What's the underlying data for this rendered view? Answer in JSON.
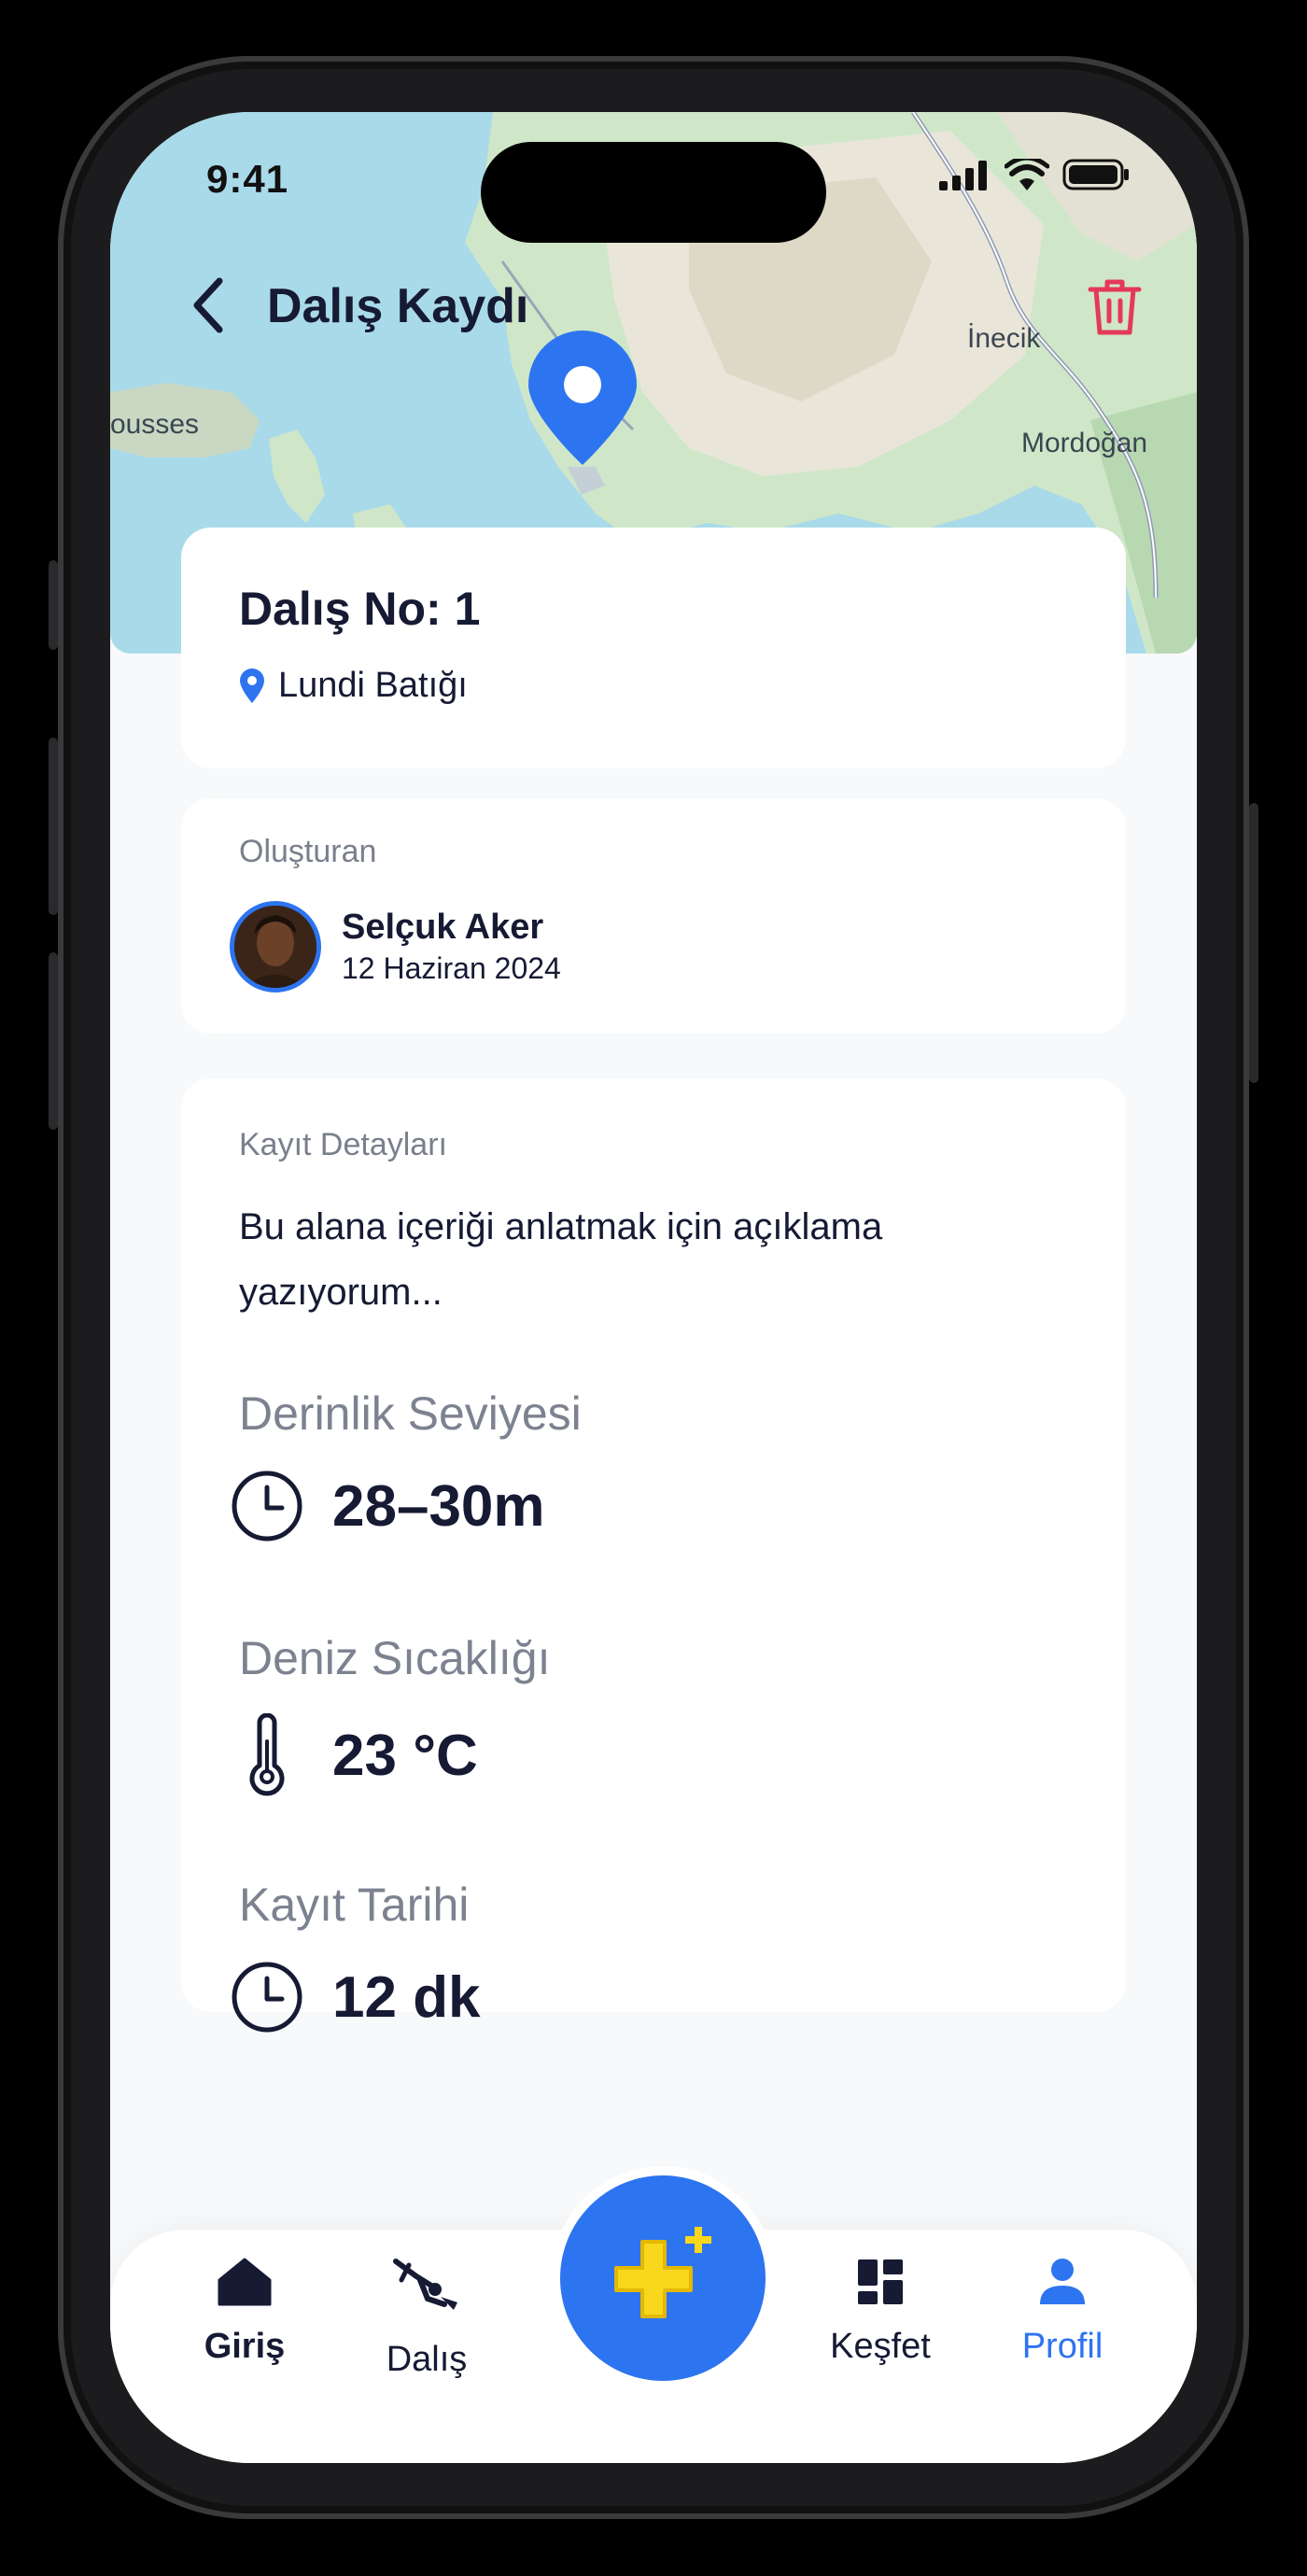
{
  "status_bar": {
    "time": "9:41"
  },
  "header": {
    "title": "Dalış Kaydı"
  },
  "map": {
    "labels": {
      "left_town": "ousses",
      "inecik": "İnecik",
      "mordogan": "Mordoğan"
    }
  },
  "dive": {
    "title": "Dalış No: 1",
    "location": "Lundi Batığı"
  },
  "creator": {
    "section_label": "Oluşturan",
    "name": "Selçuk Aker",
    "date": "12 Haziran 2024"
  },
  "details": {
    "section_label": "Kayıt Detayları",
    "description": "Bu alana içeriği anlatmak için açıklama yazıyorum...",
    "depth_label": "Derinlik Seviyesi",
    "depth_value": "28–30m",
    "temp_label": "Deniz Sıcaklığı",
    "temp_value": "23 °C",
    "duration_label": "Kayıt Tarihi",
    "duration_value": "12 dk"
  },
  "nav": {
    "items": [
      {
        "label": "Giriş",
        "icon": "home-icon"
      },
      {
        "label": "Dalış",
        "icon": "diver-icon"
      },
      {
        "label": "Keşfet",
        "icon": "grid-icon"
      },
      {
        "label": "Profil",
        "icon": "person-icon"
      }
    ],
    "active": "Profil"
  },
  "colors": {
    "accent": "#2d74f0",
    "trash": "#e53958",
    "fab_plus": "#f9d71c",
    "text_dark": "#161a33",
    "text_muted": "#7d8290"
  }
}
